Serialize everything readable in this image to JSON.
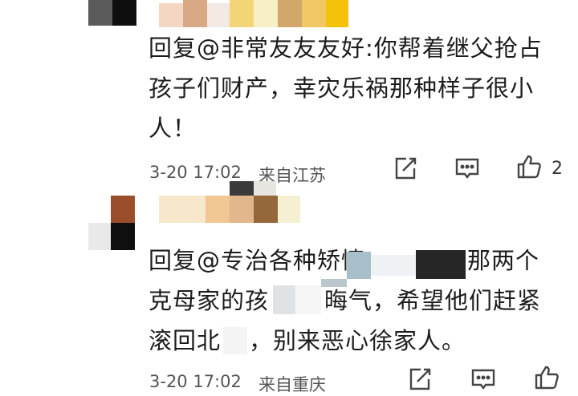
{
  "comment1": {
    "reply_text": "回复@非常友友友好:你帮着继父抢占孩子们财产，幸灾乐祸那种样子很小人！",
    "line1": "回复@非常友友友好:你帮着继父抢占",
    "line2": "孩子们财产，幸灾乐祸那种样子很小",
    "line3": "人！",
    "timestamp": "3-20 17:02",
    "location": "来自江苏",
    "like_count": "2"
  },
  "comment2": {
    "line1_prefix": "回复@专治各种矫情",
    "line1_suffix": "那两个",
    "line2_prefix": "克母家的孩",
    "line2_suffix": "晦气，希望他们赶紧",
    "line3_prefix": "滚回北",
    "line3_suffix": "，别来恶心徐家人。",
    "timestamp": "3-20 17:02",
    "location": "来自重庆"
  },
  "colors": {
    "text": "#1c1c1c",
    "meta": "#555555",
    "icon": "#444444"
  },
  "icons": [
    "edit-icon",
    "comment-icon",
    "thumbs-up-icon"
  ]
}
